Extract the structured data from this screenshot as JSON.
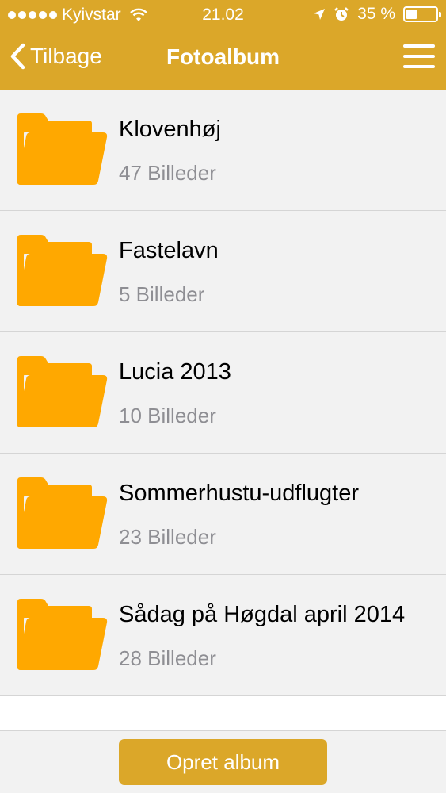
{
  "status_bar": {
    "carrier": "Kyivstar",
    "time": "21.02",
    "battery_percent": "35 %",
    "battery_level": 0.35
  },
  "nav": {
    "back_label": "Tilbage",
    "title": "Fotoalbum"
  },
  "albums": [
    {
      "name": "Klovenhøj",
      "count": "47 Billeder"
    },
    {
      "name": "Fastelavn",
      "count": "5 Billeder"
    },
    {
      "name": "Lucia 2013",
      "count": "10 Billeder"
    },
    {
      "name": "Sommerhustu-udflugter",
      "count": "23 Billeder"
    },
    {
      "name": "Sådag på Høgdal april 2014",
      "count": "28 Billeder"
    }
  ],
  "footer": {
    "create_label": "Opret album"
  },
  "colors": {
    "accent": "#dba729",
    "folder": "#ffa800"
  },
  "icons": {
    "back": "chevron-left-icon",
    "menu": "hamburger-menu-icon",
    "folder": "folder-icon",
    "wifi": "wifi-icon",
    "location": "location-arrow-icon",
    "alarm": "alarm-clock-icon",
    "battery": "battery-icon"
  }
}
